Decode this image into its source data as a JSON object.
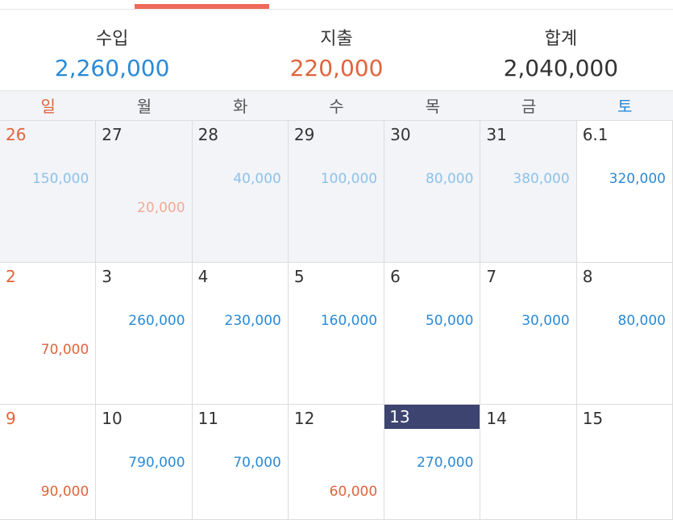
{
  "colors": {
    "income": "#2a8ad6",
    "expense": "#e0643c",
    "income_dim": "#8cc2ea",
    "expense_dim": "#f2aa94",
    "sunday": "#e0643c",
    "saturday": "#2a8ad6",
    "text": "#333333"
  },
  "summary": [
    {
      "label": "수입",
      "value": "2,260,000",
      "kind": "income"
    },
    {
      "label": "지출",
      "value": "220,000",
      "kind": "expense"
    },
    {
      "label": "합계",
      "value": "2,040,000",
      "kind": "total"
    }
  ],
  "weekdays": [
    "일",
    "월",
    "화",
    "수",
    "목",
    "금",
    "토"
  ],
  "days": [
    {
      "day": "26",
      "income": "150,000",
      "expense": "",
      "other_month": true
    },
    {
      "day": "27",
      "income": "",
      "expense": "20,000",
      "other_month": true
    },
    {
      "day": "28",
      "income": "40,000",
      "expense": "",
      "other_month": true
    },
    {
      "day": "29",
      "income": "100,000",
      "expense": "",
      "other_month": true
    },
    {
      "day": "30",
      "income": "80,000",
      "expense": "",
      "other_month": true
    },
    {
      "day": "31",
      "income": "380,000",
      "expense": "",
      "other_month": true
    },
    {
      "day": "6.1",
      "income": "320,000",
      "expense": "",
      "other_month": false
    },
    {
      "day": "2",
      "income": "",
      "expense": "70,000",
      "other_month": false
    },
    {
      "day": "3",
      "income": "260,000",
      "expense": "",
      "other_month": false
    },
    {
      "day": "4",
      "income": "230,000",
      "expense": "",
      "other_month": false
    },
    {
      "day": "5",
      "income": "160,000",
      "expense": "",
      "other_month": false
    },
    {
      "day": "6",
      "income": "50,000",
      "expense": "",
      "other_month": false
    },
    {
      "day": "7",
      "income": "30,000",
      "expense": "",
      "other_month": false
    },
    {
      "day": "8",
      "income": "80,000",
      "expense": "",
      "other_month": false
    },
    {
      "day": "9",
      "income": "",
      "expense": "90,000",
      "other_month": false
    },
    {
      "day": "10",
      "income": "790,000",
      "expense": "",
      "other_month": false
    },
    {
      "day": "11",
      "income": "70,000",
      "expense": "",
      "other_month": false
    },
    {
      "day": "12",
      "income": "",
      "expense": "60,000",
      "other_month": false
    },
    {
      "day": "13",
      "income": "270,000",
      "expense": "",
      "other_month": false,
      "today": true
    },
    {
      "day": "14",
      "income": "",
      "expense": "",
      "other_month": false
    },
    {
      "day": "15",
      "income": "",
      "expense": "",
      "other_month": false
    }
  ]
}
